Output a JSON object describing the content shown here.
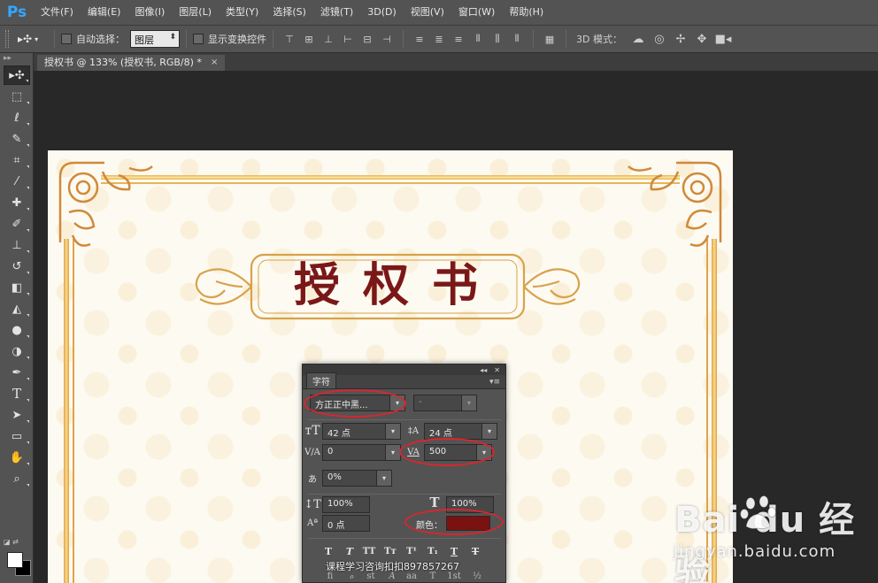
{
  "app": {
    "logo": "Ps"
  },
  "menu": {
    "items": [
      {
        "label": "文件(F)"
      },
      {
        "label": "编辑(E)"
      },
      {
        "label": "图像(I)"
      },
      {
        "label": "图层(L)"
      },
      {
        "label": "类型(Y)"
      },
      {
        "label": "选择(S)"
      },
      {
        "label": "滤镜(T)"
      },
      {
        "label": "3D(D)"
      },
      {
        "label": "视图(V)"
      },
      {
        "label": "窗口(W)"
      },
      {
        "label": "帮助(H)"
      }
    ]
  },
  "options": {
    "auto_select_label": "自动选择：",
    "auto_select_value": "图层",
    "show_transform_label": "显示变换控件",
    "mode3d_label": "3D 模式："
  },
  "document": {
    "tab_title": "授权书 @ 133% (授权书, RGB/8) *",
    "close_glyph": "×",
    "certificate_title": "授权书"
  },
  "character_panel": {
    "tab": "字符",
    "font_family": "方正正中黑...",
    "font_style": "-",
    "font_size": "42 点",
    "leading": "24 点",
    "kerning": "0",
    "tracking": "500",
    "scale_vertical_proportion": "0%",
    "vertical_scale": "100%",
    "horizontal_scale": "100%",
    "baseline_shift": "0 点",
    "color_label": "颜色：",
    "color_value": "#7a1212"
  },
  "overlay": {
    "consult_text": "课程学习咨询扣扣897857267"
  },
  "watermark": {
    "brand": "Bai   du 经验",
    "url": "jingyan.baidu.com"
  },
  "colors": {
    "annotation_red": "#d9262d",
    "certificate_red": "#7a1818",
    "gold_frame": "#e2a24a"
  }
}
